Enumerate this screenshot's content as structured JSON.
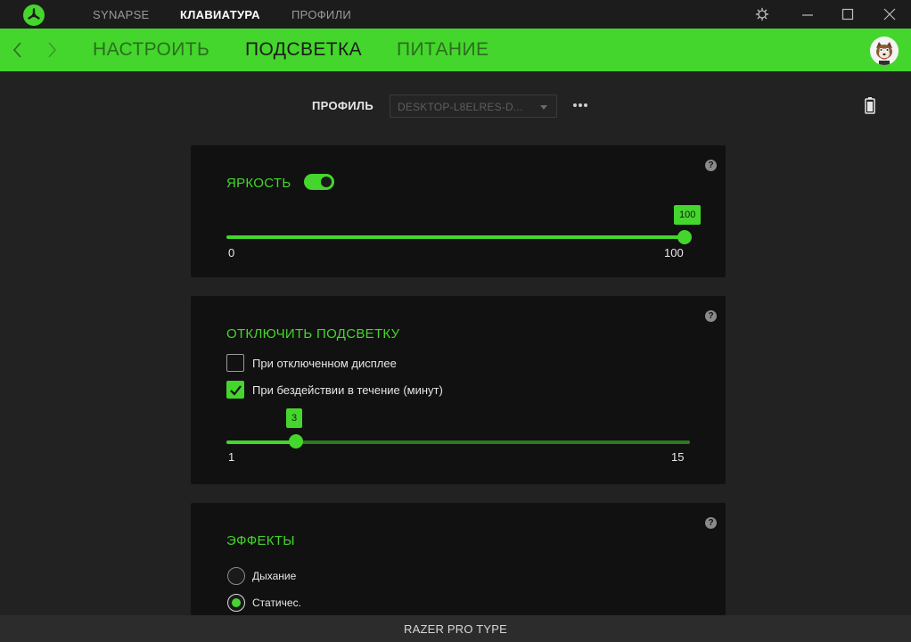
{
  "titlebar": {
    "tabs": [
      "SYNAPSE",
      "КЛАВИАТУРА",
      "ПРОФИЛИ"
    ],
    "active_tab": "КЛАВИАТУРА",
    "logo_icon": "razer-logo-icon",
    "buttons": [
      "settings-icon",
      "minimize-icon",
      "maximize-icon",
      "close-icon"
    ]
  },
  "nav": {
    "tabs": [
      "НАСТРОИТЬ",
      "ПОДСВЕТКА",
      "ПИТАНИЕ"
    ],
    "active_tab": "ПОДСВЕТКА"
  },
  "profile": {
    "label": "ПРОФИЛЬ",
    "value": "DESKTOP-L8ELRES-D..."
  },
  "brightness": {
    "title": "ЯРКОСТЬ",
    "enabled": true,
    "value": "100",
    "min": "0",
    "max": "100"
  },
  "lighting_off": {
    "title": "ОТКЛЮЧИТЬ ПОДСВЕТКУ",
    "options": [
      {
        "label": "При отключенном дисплее",
        "checked": false
      },
      {
        "label": "При бездействии в течение (минут)",
        "checked": true
      }
    ],
    "value": "3",
    "min": "1",
    "max": "15"
  },
  "effects": {
    "title": "ЭФФЕКТЫ",
    "options": [
      {
        "label": "Дыхание",
        "selected": false
      },
      {
        "label": "Статичес.",
        "selected": true
      }
    ]
  },
  "footer": {
    "device": "RAZER PRO TYPE"
  },
  "colors": {
    "accent": "#44d62c",
    "bg": "#222222",
    "card": "#111111"
  }
}
